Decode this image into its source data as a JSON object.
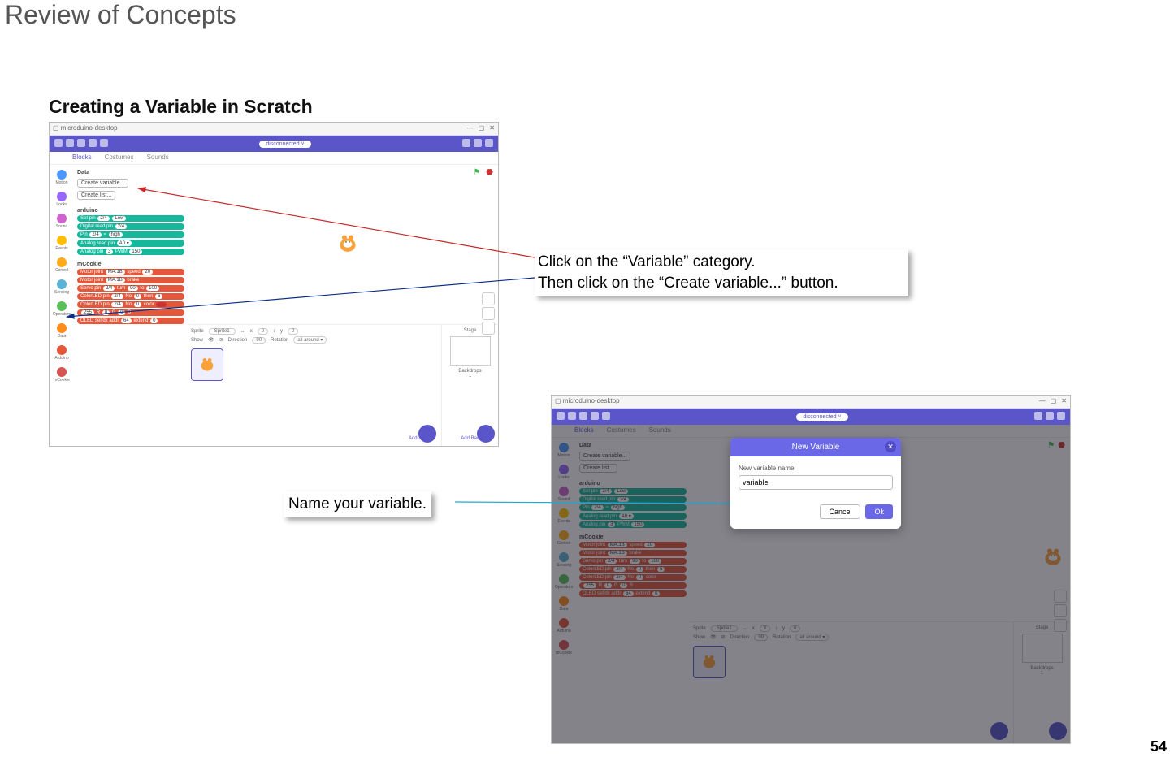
{
  "page_title": "Review of Concepts",
  "section_title": "Creating a Variable in Scratch",
  "page_number": "54",
  "callout1_line1": "Click on the “Variable” category.",
  "callout1_line2": "Then click on the “Create variable...” button.",
  "callout2": "Name your variable.",
  "window": {
    "app_name": "microduino-desktop",
    "disconnected": "disconnected",
    "tabs": {
      "blocks": "Blocks",
      "costumes": "Costumes",
      "sounds": "Sounds"
    }
  },
  "categories": {
    "motion": "Motion",
    "looks": "Looks",
    "sound": "Sound",
    "events": "Events",
    "control": "Control",
    "sensing": "Sensing",
    "operators": "Operators",
    "data": "Data",
    "arduino": "Arduino",
    "mcookie": "mCookie"
  },
  "palette": {
    "data_heading": "Data",
    "create_variable": "Create variable...",
    "create_list": "Create list...",
    "arduino_heading": "arduino",
    "mcookie_heading": "mCookie",
    "blocks": {
      "setpin": "Set pin",
      "digread": "Digital read pin",
      "pin": "Pin",
      "analogread": "Analog read pin",
      "analogpin": "Analog pin",
      "pwm": "PWM",
      "motorjoint": "Motor joint",
      "speed": "speed",
      "brake": "brake",
      "servopin": "Servo pin",
      "turn": "turn",
      "to": "to",
      "then": "then",
      "colorled": "ColorLED pin",
      "no": "No",
      "r": "R",
      "g": "G",
      "b": "B",
      "color": "color",
      "oled": "OLED selfdx addr",
      "extend": "extend",
      "val24": "2/4",
      "low": "Low",
      "high": "high",
      "val6": "6",
      "val3": "3",
      "val150": "150",
      "ma1b": "MA.1B",
      "val20": "20",
      "val90": "90",
      "val100": "100",
      "val0": "0",
      "val255": "255",
      "val64": "64"
    }
  },
  "sprite_panel": {
    "sprite_label": "Sprite",
    "sprite_name": "Sprite1",
    "x": "x",
    "y": "y",
    "x_val": "0",
    "y_val": "0",
    "show": "Show",
    "direction": "Direction",
    "dir_val": "90",
    "rotation": "Rotation",
    "rot_val": "all around",
    "stage_label": "Stage",
    "backdrops": "Backdrops",
    "backdrops_n": "1",
    "add_sprite": "Add Sprite",
    "add_backdrop": "Add Backdrop"
  },
  "modal": {
    "title": "New Variable",
    "field_label": "New variable name",
    "input_value": "variable",
    "cancel": "Cancel",
    "ok": "Ok"
  },
  "colors": {
    "motion": "#4c97ff",
    "looks": "#9966ff",
    "sound": "#cf63cf",
    "events": "#ffbf00",
    "control": "#ffab19",
    "sensing": "#5cb1d6",
    "operators": "#59c059",
    "data": "#ff8c1a",
    "arduino": "#e5573b",
    "mcookie": "#d65454"
  }
}
